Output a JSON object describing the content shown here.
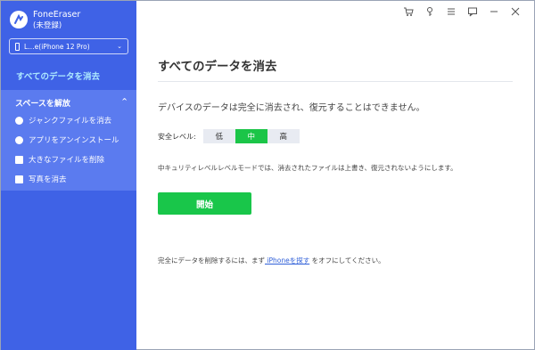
{
  "app": {
    "name": "FoneEraser",
    "status": "(未登録)"
  },
  "device": {
    "name": "L…e(iPhone 12 Pro)"
  },
  "sidebar": {
    "erase_all": "すべてのデータを消去",
    "section_title": "スペースを解放",
    "items": [
      {
        "label": "ジャンクファイルを消去",
        "icon": "clock-icon"
      },
      {
        "label": "アプリをアンインストール",
        "icon": "rocket-icon"
      },
      {
        "label": "大きなファイルを削除",
        "icon": "file-icon"
      },
      {
        "label": "写真を消去",
        "icon": "photo-icon"
      }
    ]
  },
  "titlebar": {
    "icons": [
      "cart-icon",
      "key-icon",
      "menu-icon",
      "feedback-icon",
      "minimize-icon",
      "close-icon"
    ]
  },
  "main": {
    "title": "すべてのデータを消去",
    "description": "デバイスのデータは完全に消去され、復元することはできません。",
    "security_label": "安全レベル:",
    "levels": [
      "低",
      "中",
      "高"
    ],
    "selected_level": "中",
    "note": "中キュリティレベルレベルモードでは、消去されたファイルは上書き、復元されないようにします。",
    "start_label": "開始",
    "footer_prefix": "完全にデータを削除するには、まず",
    "footer_link": " iPhoneを探す",
    "footer_suffix": " をオフにしてください。"
  },
  "colors": {
    "sidebar": "#3f62e6",
    "section": "#5b7bef",
    "accent_green": "#19c64a",
    "link": "#2f5fd8"
  }
}
